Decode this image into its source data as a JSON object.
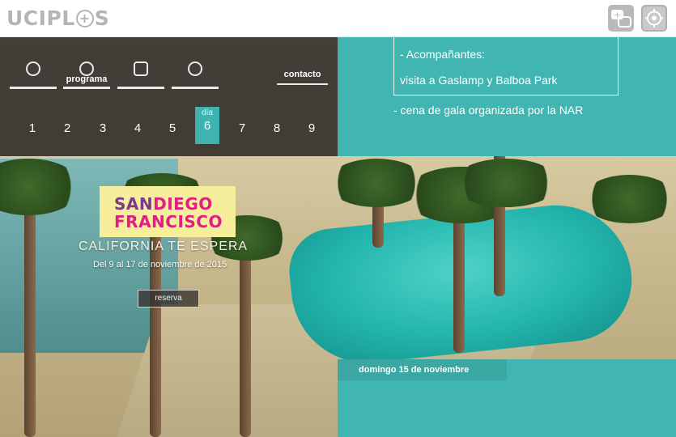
{
  "brand": {
    "logo_left": "UCIPL",
    "logo_plus": "+",
    "logo_right": "S"
  },
  "toolbar": {
    "icons": [
      "chat-icon",
      "settings-icon"
    ]
  },
  "menu": {
    "items": [
      {
        "icon": "leaf-icon",
        "label": ""
      },
      {
        "icon": "clock-icon",
        "label": "programa"
      },
      {
        "icon": "hotel-icon",
        "label": ""
      },
      {
        "icon": "home-icon",
        "label": ""
      }
    ],
    "contact_label": "contacto",
    "day_label": "día",
    "days": [
      "1",
      "2",
      "3",
      "4",
      "5",
      "6",
      "7",
      "8",
      "9"
    ],
    "selected_day": "6"
  },
  "program": {
    "line1": "- Acompañantes:",
    "line2": "visita a Gaslamp y Balboa Park",
    "line3": "- cena de gala organizada por la NAR"
  },
  "promo": {
    "city_a1": "SAN",
    "city_b1": "DIEGO",
    "city_b2": "FRANCISCO",
    "tagline": "CALIFORNIA TE ESPERA",
    "dates": "Del 9 al 17 de noviembre de 2015",
    "cta": "reserva"
  },
  "schedule": {
    "date_label": "domingo 15 de noviembre"
  },
  "colors": {
    "teal": "#41b5b1",
    "panel": "#2a2624",
    "promo_yellow": "#f6ee9a",
    "promo_purple": "#7a3b8c",
    "promo_pink": "#e11d86"
  }
}
